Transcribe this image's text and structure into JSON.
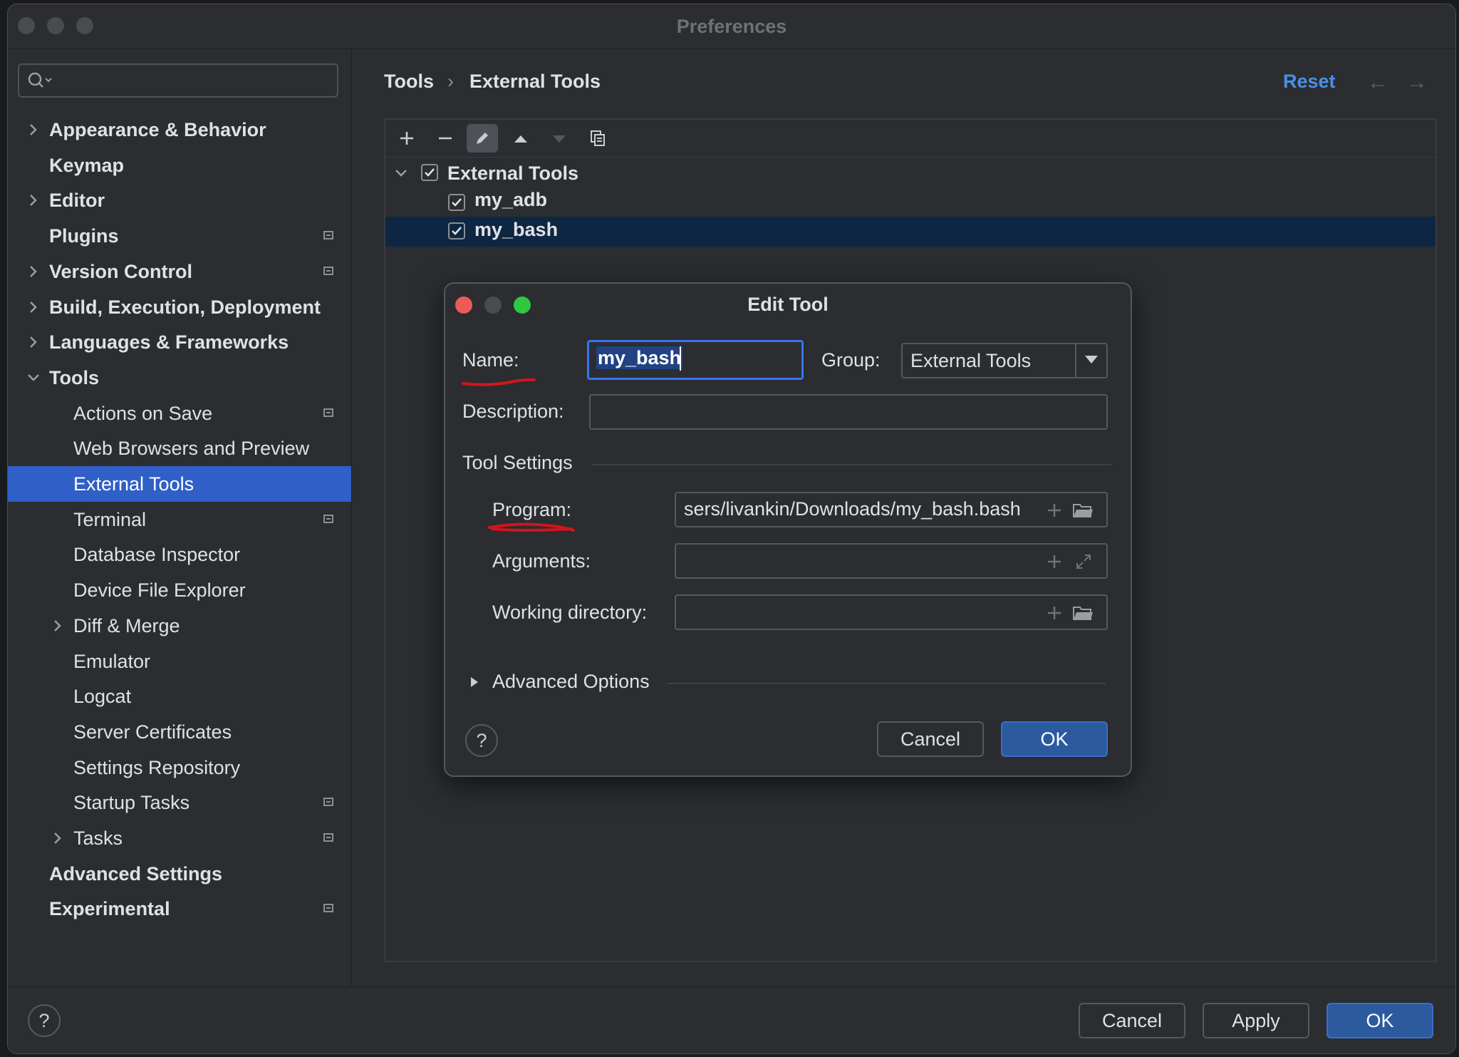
{
  "window": {
    "title": "Preferences"
  },
  "sidebar": {
    "search_placeholder": "",
    "items": [
      {
        "label": "Appearance & Behavior",
        "expandable": true,
        "expanded": false,
        "bold": true,
        "indent": 0,
        "badge": false
      },
      {
        "label": "Keymap",
        "expandable": false,
        "bold": true,
        "indent": 0,
        "badge": false
      },
      {
        "label": "Editor",
        "expandable": true,
        "expanded": false,
        "bold": true,
        "indent": 0,
        "badge": false
      },
      {
        "label": "Plugins",
        "expandable": false,
        "bold": true,
        "indent": 0,
        "badge": true
      },
      {
        "label": "Version Control",
        "expandable": true,
        "expanded": false,
        "bold": true,
        "indent": 0,
        "badge": true
      },
      {
        "label": "Build, Execution, Deployment",
        "expandable": true,
        "expanded": false,
        "bold": true,
        "indent": 0,
        "badge": false
      },
      {
        "label": "Languages & Frameworks",
        "expandable": true,
        "expanded": false,
        "bold": true,
        "indent": 0,
        "badge": false
      },
      {
        "label": "Tools",
        "expandable": true,
        "expanded": true,
        "bold": true,
        "indent": 0,
        "badge": false
      },
      {
        "label": "Actions on Save",
        "expandable": false,
        "bold": false,
        "indent": 1,
        "badge": true
      },
      {
        "label": "Web Browsers and Preview",
        "expandable": false,
        "bold": false,
        "indent": 1,
        "badge": false
      },
      {
        "label": "External Tools",
        "expandable": false,
        "bold": false,
        "indent": 1,
        "badge": false,
        "selected": true
      },
      {
        "label": "Terminal",
        "expandable": false,
        "bold": false,
        "indent": 1,
        "badge": true
      },
      {
        "label": "Database Inspector",
        "expandable": false,
        "bold": false,
        "indent": 1,
        "badge": false
      },
      {
        "label": "Device File Explorer",
        "expandable": false,
        "bold": false,
        "indent": 1,
        "badge": false
      },
      {
        "label": "Diff & Merge",
        "expandable": true,
        "expanded": false,
        "bold": false,
        "indent": 1,
        "badge": false
      },
      {
        "label": "Emulator",
        "expandable": false,
        "bold": false,
        "indent": 1,
        "badge": false
      },
      {
        "label": "Logcat",
        "expandable": false,
        "bold": false,
        "indent": 1,
        "badge": false
      },
      {
        "label": "Server Certificates",
        "expandable": false,
        "bold": false,
        "indent": 1,
        "badge": false
      },
      {
        "label": "Settings Repository",
        "expandable": false,
        "bold": false,
        "indent": 1,
        "badge": false
      },
      {
        "label": "Startup Tasks",
        "expandable": false,
        "bold": false,
        "indent": 1,
        "badge": true
      },
      {
        "label": "Tasks",
        "expandable": true,
        "expanded": false,
        "bold": false,
        "indent": 1,
        "badge": true
      },
      {
        "label": "Advanced Settings",
        "expandable": false,
        "bold": true,
        "indent": 0,
        "badge": false
      },
      {
        "label": "Experimental",
        "expandable": false,
        "bold": true,
        "indent": 0,
        "badge": true
      }
    ]
  },
  "header": {
    "breadcrumb_parent": "Tools",
    "breadcrumb_separator": "›",
    "breadcrumb_current": "External Tools",
    "reset_label": "Reset",
    "back_arrow": "←",
    "forward_arrow": "→"
  },
  "toolbar": {
    "icons": [
      "add-icon",
      "remove-icon",
      "edit-icon",
      "move-up-icon",
      "move-down-icon",
      "copy-icon"
    ]
  },
  "tree": {
    "group_label": "External Tools",
    "group_checked": true,
    "items": [
      {
        "label": "my_adb",
        "checked": true,
        "selected": false
      },
      {
        "label": "my_bash",
        "checked": true,
        "selected": true
      }
    ]
  },
  "dialog": {
    "title": "Edit Tool",
    "name_label": "Name:",
    "name_value": "my_bash",
    "group_label": "Group:",
    "group_value": "External Tools",
    "description_label": "Description:",
    "description_value": "",
    "tool_settings_label": "Tool Settings",
    "program_label": "Program:",
    "program_value": "sers/livankin/Downloads/my_bash.bash",
    "arguments_label": "Arguments:",
    "arguments_value": "",
    "working_dir_label": "Working directory:",
    "working_dir_value": "",
    "advanced_label": "Advanced Options",
    "help_label": "?",
    "cancel_label": "Cancel",
    "ok_label": "OK"
  },
  "footer": {
    "help_label": "?",
    "cancel_label": "Cancel",
    "apply_label": "Apply",
    "ok_label": "OK"
  },
  "colors": {
    "accent": "#2f5fc7",
    "annotation_red": "#d0161c",
    "link_blue": "#4a8fe7"
  }
}
